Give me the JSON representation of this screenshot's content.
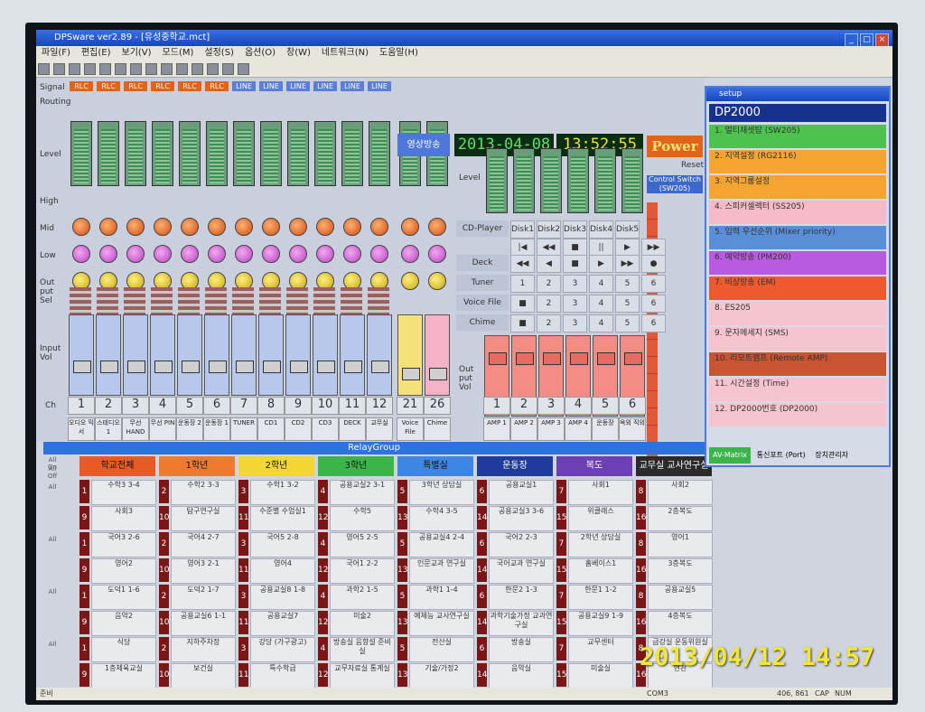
{
  "window": {
    "title": "DPSware ver2.89 - [유성중학교.mct]"
  },
  "menu": [
    "파일(F)",
    "편집(E)",
    "보기(V)",
    "모드(M)",
    "설정(S)",
    "옵션(O)",
    "창(W)",
    "네트워크(N)",
    "도움말(H)"
  ],
  "mixer": {
    "signal_label": "Signal",
    "routing_label": "Routing",
    "level_label": "Level",
    "high_label": "High",
    "mid_label": "Mid",
    "low_label": "Low",
    "outsel_label": "Out put Sel",
    "inputvol_label": "Input Vol",
    "ch_label": "Ch",
    "all_label": "All",
    "signals": [
      "RLC",
      "RLC",
      "RLC",
      "RLC",
      "RLC",
      "RLC",
      "LINE",
      "LINE",
      "LINE",
      "LINE",
      "LINE",
      "LINE"
    ],
    "channels": [
      {
        "num": "1",
        "name": "오디오 믹서"
      },
      {
        "num": "2",
        "name": "스테디오 1"
      },
      {
        "num": "3",
        "name": "무선 HAND"
      },
      {
        "num": "4",
        "name": "무선 PIN"
      },
      {
        "num": "5",
        "name": "운동장 2"
      },
      {
        "num": "6",
        "name": "운동장 1"
      },
      {
        "num": "7",
        "name": "TUNER"
      },
      {
        "num": "8",
        "name": "CD1"
      },
      {
        "num": "9",
        "name": "CD2"
      },
      {
        "num": "10",
        "name": "CD3"
      },
      {
        "num": "11",
        "name": "DECK"
      },
      {
        "num": "12",
        "name": "교무실"
      },
      {
        "num": "21",
        "name": "Voice File"
      },
      {
        "num": "26",
        "name": "Chime"
      }
    ],
    "video_button": "영상방송",
    "date": "2013-04-08",
    "time": "13:52:55",
    "power_label": "Power",
    "reset_label": "Reset",
    "control_switch": "Control Switch (SW205)"
  },
  "sources": {
    "level_label": "Level",
    "cd_label": "CD-Player",
    "discs": [
      "Disk1",
      "Disk2",
      "Disk3",
      "Disk4",
      "Disk5"
    ],
    "deck_label": "Deck",
    "tuner_label": "Tuner",
    "voicefile_label": "Voice File",
    "chime_label": "Chime",
    "outvol_label": "Out put Vol",
    "numbers": [
      "1",
      "2",
      "3",
      "4",
      "5",
      "6"
    ],
    "amps": [
      {
        "num": "1",
        "name": "AMP 1"
      },
      {
        "num": "2",
        "name": "AMP 2"
      },
      {
        "num": "3",
        "name": "AMP 3"
      },
      {
        "num": "4",
        "name": "AMP 4"
      },
      {
        "num": "5",
        "name": "운동장"
      },
      {
        "num": "6",
        "name": "옥외 직외"
      }
    ]
  },
  "relay": {
    "title": "RelayGroup",
    "all_on": "All On",
    "all_off": "All Off",
    "groups": [
      {
        "label": "학교전체",
        "color": "#ea5a23"
      },
      {
        "label": "1학년",
        "color": "#ef7a2b"
      },
      {
        "label": "2학년",
        "color": "#f2d631"
      },
      {
        "label": "3학년",
        "color": "#3bb54a"
      },
      {
        "label": "특별실",
        "color": "#3d86e3"
      },
      {
        "label": "운동장",
        "color": "#1f3b9c"
      },
      {
        "label": "복도",
        "color": "#6c3fb5"
      },
      {
        "label": "교무실 교사연구실",
        "color": "#2b2b2b"
      }
    ],
    "rows": [
      [
        "수학3 3-4",
        "수학2 3-3",
        "수학1 3-2",
        "공용교실2 3-1",
        "3학년 상담실",
        "공용교실1",
        "사회1",
        "사회2"
      ],
      [
        "사회3",
        "탐구연구실",
        "수준별 수업실1",
        "수학5",
        "수학4 3-5",
        "공용교실3 3-6",
        "위클래스",
        "2층복도"
      ],
      [
        "국어3 2-6",
        "국어4 2-7",
        "국어5 2-8",
        "영어5 2-5",
        "공용교실4 2-4",
        "국어2 2-3",
        "2학년 상담실",
        "영어1"
      ],
      [
        "영어2",
        "영어3 2-1",
        "영어4",
        "국어1 2-2",
        "인문교과 연구실",
        "국어교과 연구실",
        "홈베이스1",
        "3층복도"
      ],
      [
        "도덕1 1-6",
        "도덕2 1-7",
        "공용교실8 1-8",
        "과학2 1-5",
        "과학1 1-4",
        "한문2 1-3",
        "한문1 1-2",
        "공용교실5"
      ],
      [
        "음악2",
        "공용교실6 1-1",
        "공용교실7",
        "미술2",
        "예체능 교사연구실",
        "과학기술가정 교과연구실",
        "공용교실9 1-9",
        "4층복도"
      ],
      [
        "식당",
        "지하주차장",
        "강당 (가구광고)",
        "방송실 음향설 준비실",
        "전산실",
        "방송실",
        "교무센터",
        "급강실 운동위원실"
      ],
      [
        "1층체육교실",
        "보건실",
        "특수학급",
        "교무자료실 통계실",
        "기술/가정2",
        "음악실",
        "미술실",
        "현관"
      ]
    ],
    "row_nums": [
      [
        "1",
        "2",
        "3",
        "4",
        "5",
        "6",
        "7",
        "8"
      ],
      [
        "9",
        "10",
        "11",
        "12",
        "13",
        "14",
        "15",
        "16"
      ]
    ]
  },
  "setup": {
    "title": "setup",
    "header": "DP2000",
    "items": [
      {
        "label": "1. 멀티채셋탐 (SW205)",
        "color": "#4dc24f"
      },
      {
        "label": "2. 지역설정 (RG2116)",
        "color": "#f4a431"
      },
      {
        "label": "3. 지역그룹설정",
        "color": "#f4a431"
      },
      {
        "label": "4. 스피커셀렉터 (SS205)",
        "color": "#f5b9c8"
      },
      {
        "label": "5. 입력 우선순위 (Mixer priority)",
        "color": "#5a8fd8"
      },
      {
        "label": "6. 예약방송 (PM200)",
        "color": "#b95be0"
      },
      {
        "label": "7. 비상방송 (EM)",
        "color": "#ee5a2e"
      },
      {
        "label": "8. ES205",
        "color": "#f5c4cf"
      },
      {
        "label": "9. 문자메세지 (SMS)",
        "color": "#f5c4cf"
      },
      {
        "label": "10. 리모트앰프 (Remote AMP)",
        "color": "#c85432"
      },
      {
        "label": "11. 시간설정 (Time)",
        "color": "#f5c4cf"
      },
      {
        "label": "12. DP2000번호 (DP2000)",
        "color": "#f5c4cf"
      }
    ],
    "footer": {
      "avmatrix": "AV-Matrix",
      "comm": "통신포트 (Port)",
      "manager": "장치관리자"
    }
  },
  "status": {
    "left": "준비",
    "com": "COM3",
    "pos": "406, 861",
    "cap": "CAP",
    "num": "NUM"
  },
  "photo_stamp": "2013/04/12 14:57"
}
